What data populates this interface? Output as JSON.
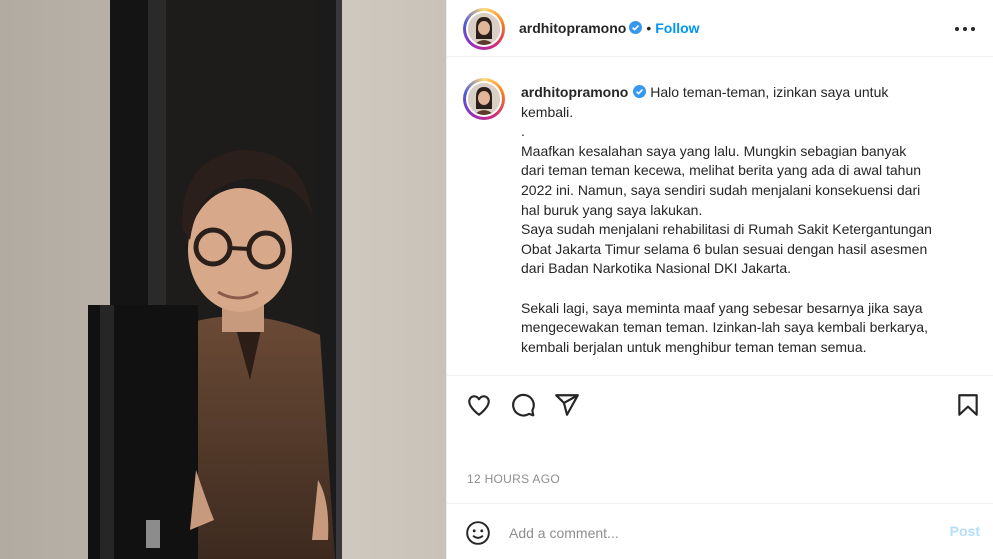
{
  "post": {
    "username": "ardhitopramono",
    "separator": "•",
    "follow_label": "Follow",
    "more_icon": "more-horizontal-icon",
    "verified_icon": "verified-badge-icon"
  },
  "caption": {
    "username": "ardhitopramono",
    "text": "Halo teman-teman, izinkan saya untuk\nkembali.\n.\nMaafkan kesalahan saya yang lalu. Mungkin sebagian banyak\ndari teman teman kecewa, melihat berita yang ada di awal tahun\n2022 ini. Namun, saya sendiri sudah menjalani konsekuensi dari\nhal buruk yang saya lakukan.\nSaya sudah menjalani rehabilitasi di Rumah Sakit Ketergantungan\nObat Jakarta Timur selama 6 bulan sesuai dengan hasil asesmen\ndari Badan Narkotika Nasional DKI Jakarta.\n\nSekali lagi, saya meminta maaf yang sebesar besarnya jika saya\nmengecewakan teman teman. Izinkan-lah saya kembali berkarya,\nkembali berjalan untuk menghibur teman teman semua."
  },
  "actions": {
    "like_icon": "heart-icon",
    "comment_icon": "comment-icon",
    "share_icon": "share-icon",
    "save_icon": "bookmark-icon"
  },
  "timestamp": "12 HOURS AGO",
  "comment_bar": {
    "emoji_icon": "emoji-icon",
    "placeholder": "Add a comment...",
    "post_label": "Post"
  },
  "colors": {
    "accent": "#0095f6",
    "post_disabled": "#b2dffc",
    "muted": "#8e8e8e",
    "text": "#262626",
    "border": "#efefef"
  }
}
